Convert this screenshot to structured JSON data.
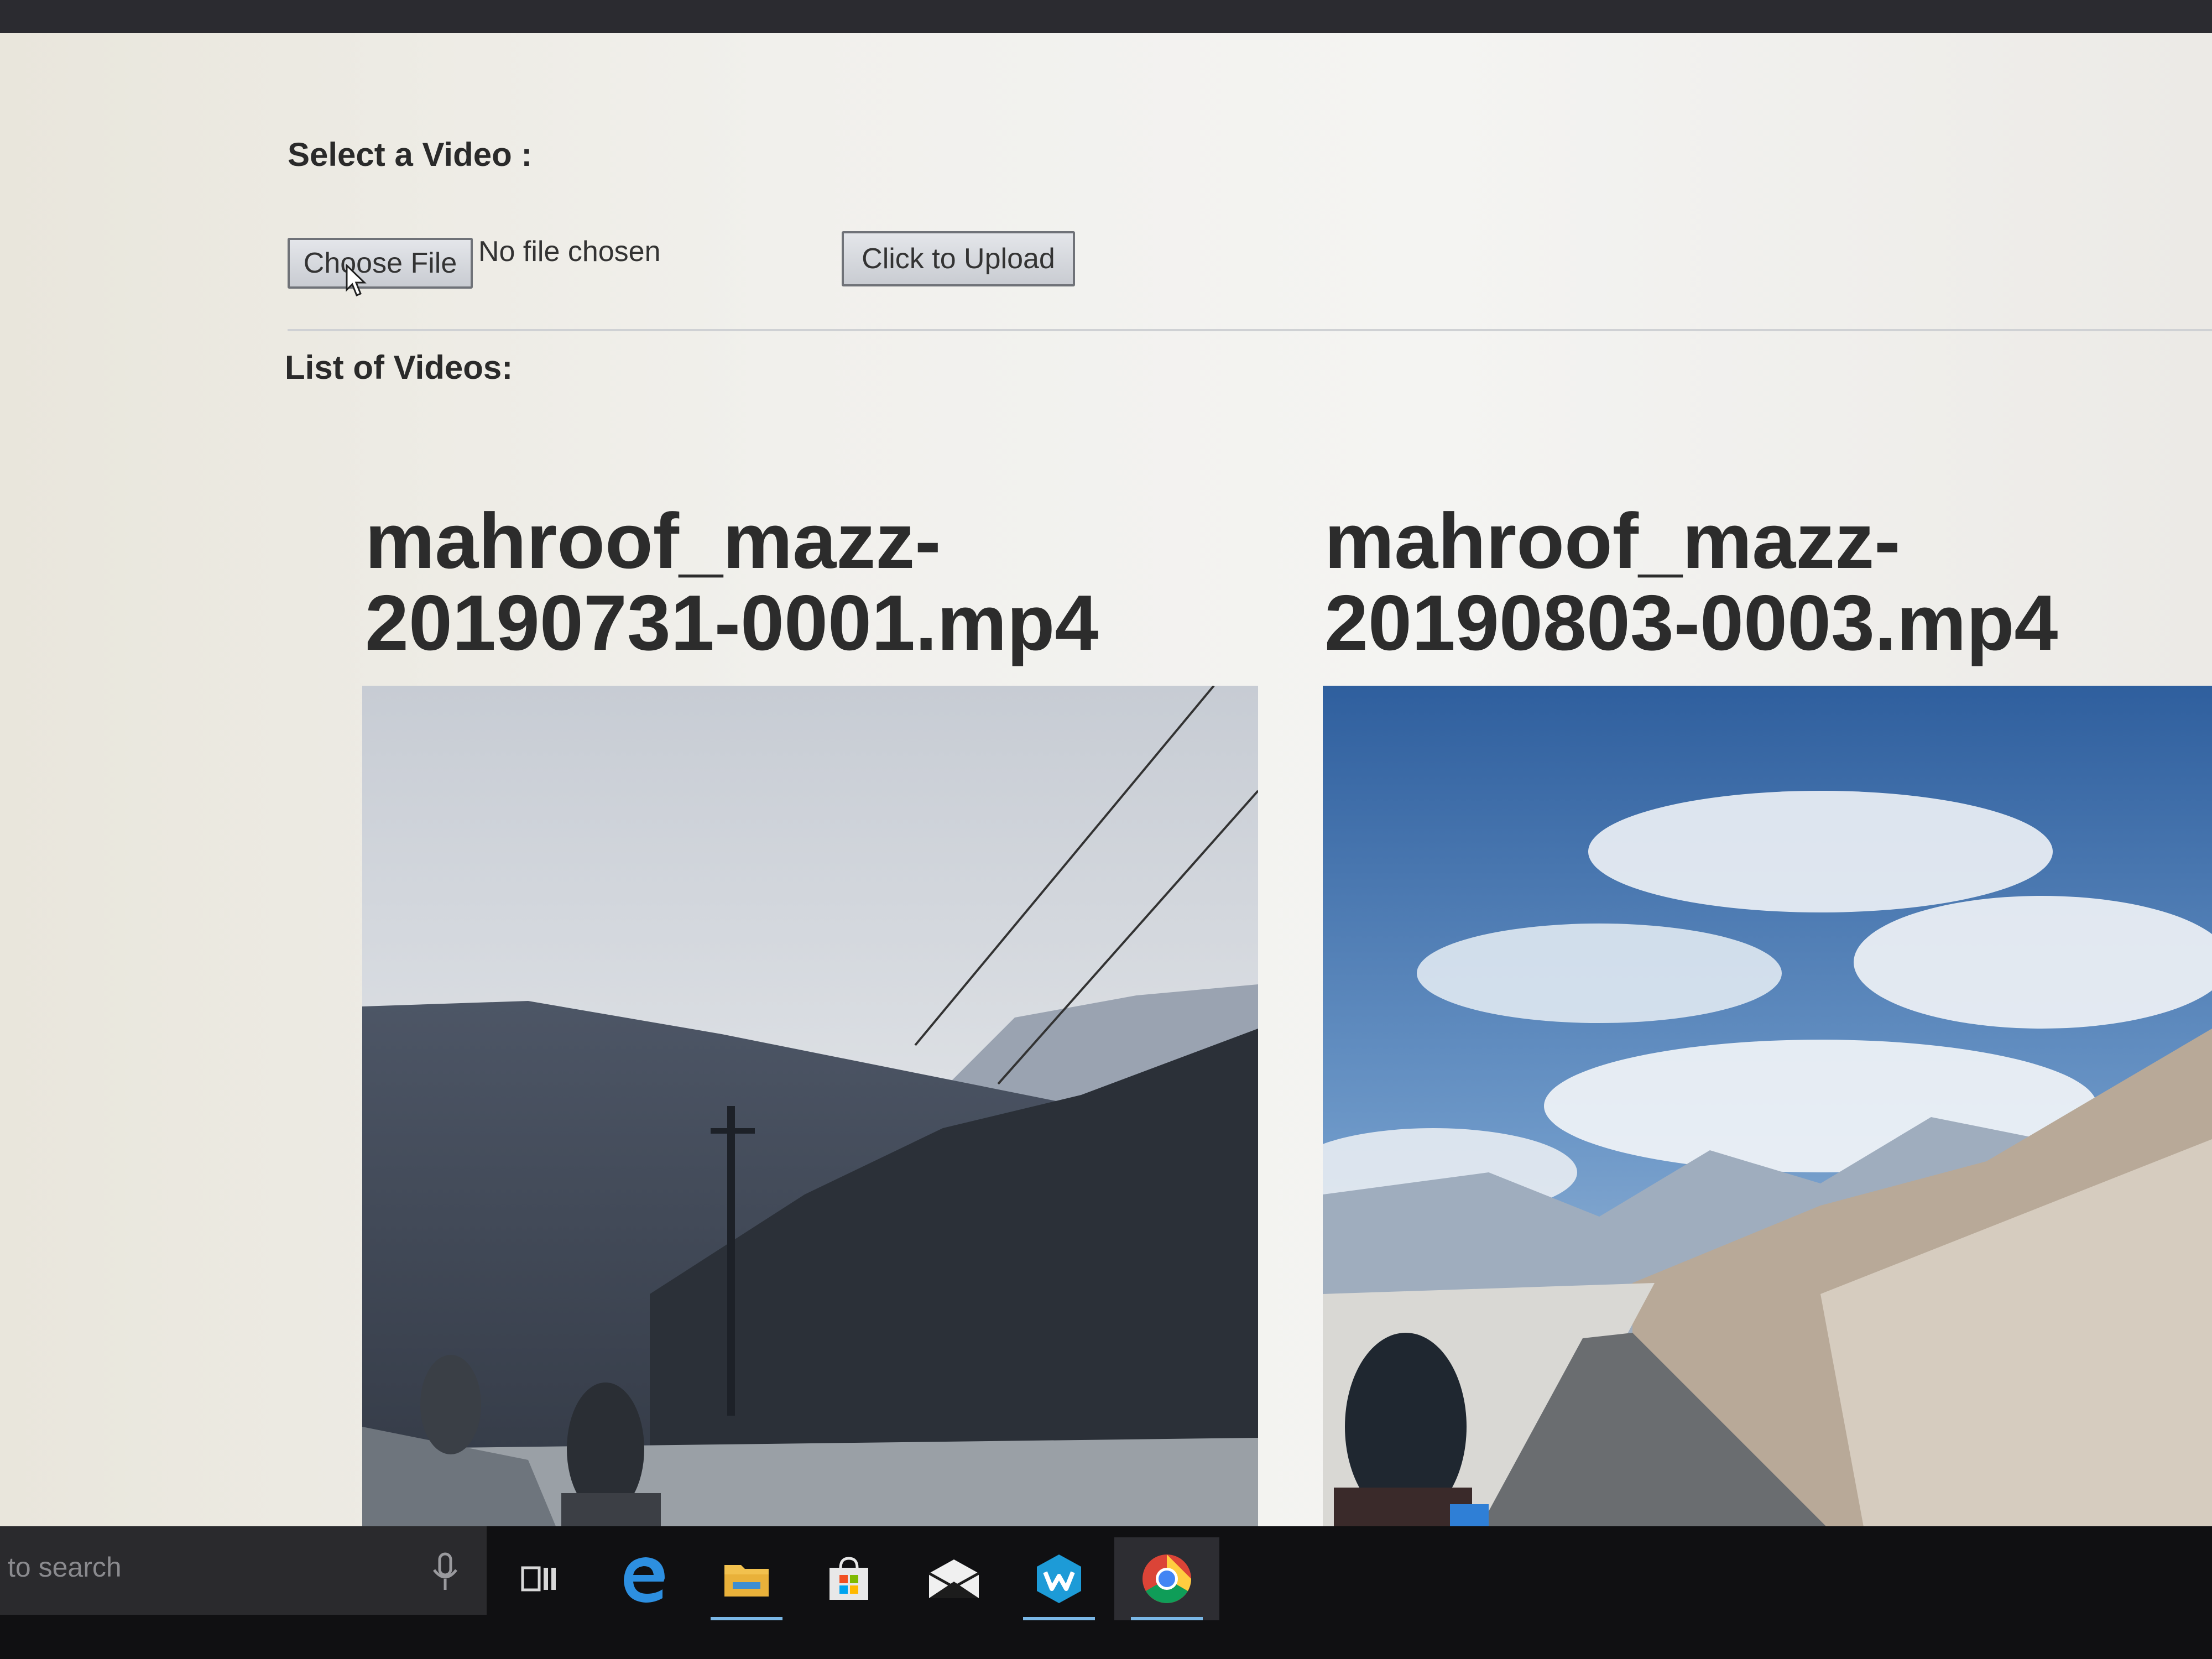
{
  "upload": {
    "select_label": "Select a Video :",
    "choose_file_label": "Choose File",
    "no_file_text": "No file chosen",
    "upload_button_label": "Click to Upload"
  },
  "list": {
    "label": "List of Videos:",
    "videos": [
      {
        "title": "mahroof_mazz-20190731-0001.mp4"
      },
      {
        "title": "mahroof_mazz-20190803-0003.mp4"
      }
    ]
  },
  "taskbar": {
    "search_placeholder": "to search",
    "icons": [
      "microphone-icon",
      "task-view-icon",
      "edge-icon",
      "file-explorer-icon",
      "store-icon",
      "mail-icon",
      "wps-icon",
      "chrome-icon"
    ]
  },
  "colors": {
    "accent": "#7ab7e6",
    "taskbar": "#101012"
  }
}
